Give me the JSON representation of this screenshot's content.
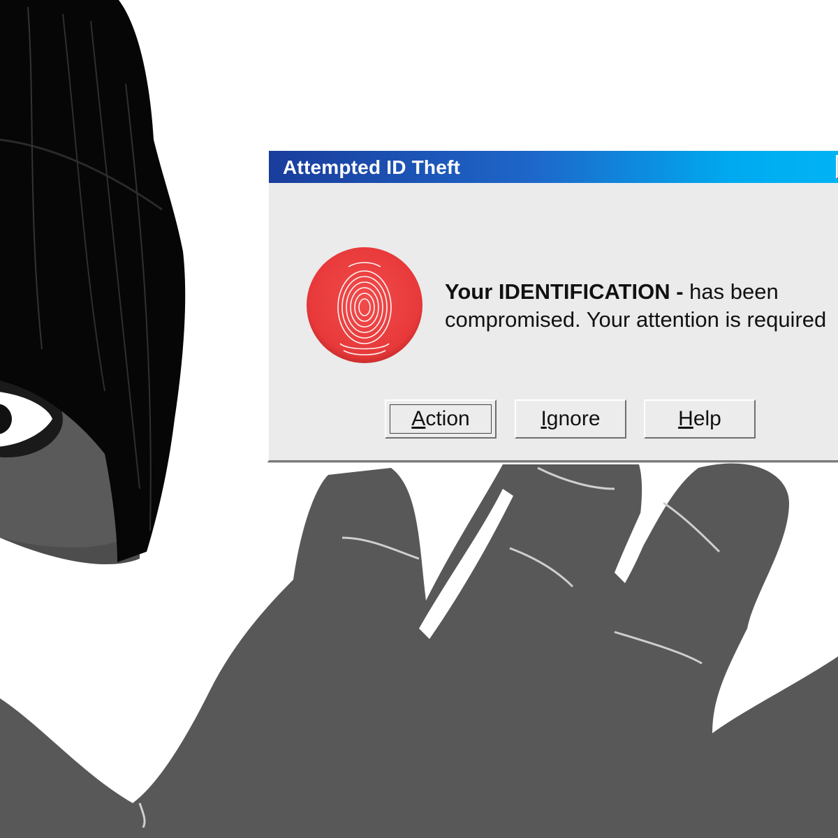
{
  "dialog": {
    "title": "Attempted ID Theft",
    "icon": "fingerprint-icon",
    "message_bold": "Your IDENTIFICATION -",
    "message_rest_line1": " has been",
    "message_line2": "compromised. Your attention is required",
    "buttons": [
      {
        "accesskey": "A",
        "rest": "ction",
        "default": true
      },
      {
        "accesskey": "I",
        "rest": "gnore",
        "default": false
      },
      {
        "accesskey": "H",
        "rest": "elp",
        "default": false
      }
    ]
  },
  "colors": {
    "titlebar_start": "#1a3d9c",
    "titlebar_end": "#00b4f5",
    "dialog_body": "#ebebeb",
    "icon_red": "#e8393a",
    "hand_gray": "#595959",
    "hair_black": "#050505"
  }
}
